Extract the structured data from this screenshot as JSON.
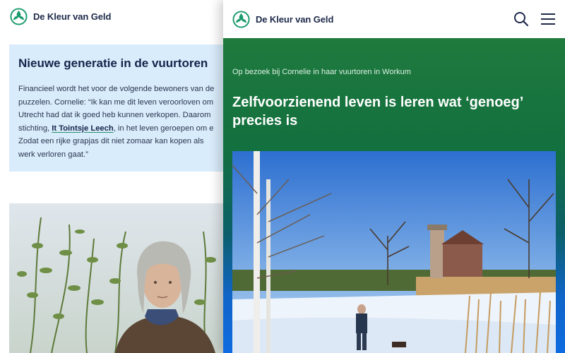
{
  "brand": {
    "name": "De Kleur van Geld",
    "color": "#1e2a4a",
    "accent": "#1a9a6c"
  },
  "left_page": {
    "card": {
      "title": "Nieuwe generatie in de vuurtoren",
      "lines": [
        "Financieel wordt het voor de volgende bewoners van de",
        "puzzelen. Cornelie: “Ik kan me dit leven veroorloven om",
        "Utrecht had dat ik goed heb kunnen verkopen. Daarom",
        "stichting, ",
        "Zodat een rijke grapjas dit niet zomaar kan kopen als",
        "werk verloren gaat.”"
      ],
      "link_text": "It Tointsje Leech",
      "line4_suffix": ", in het leven geroepen om e",
      "background": "#d9ecfb"
    }
  },
  "right_page": {
    "kicker": "Op bezoek bij Cornelie in haar vuurtoren in Workum",
    "headline": "Zelfvoorzienend leven is leren wat ‘genoeg’ precies is",
    "header_icons": [
      "search-icon",
      "menu-icon"
    ],
    "hero_colors": [
      "#1f7a3d",
      "#0f6be0"
    ]
  }
}
